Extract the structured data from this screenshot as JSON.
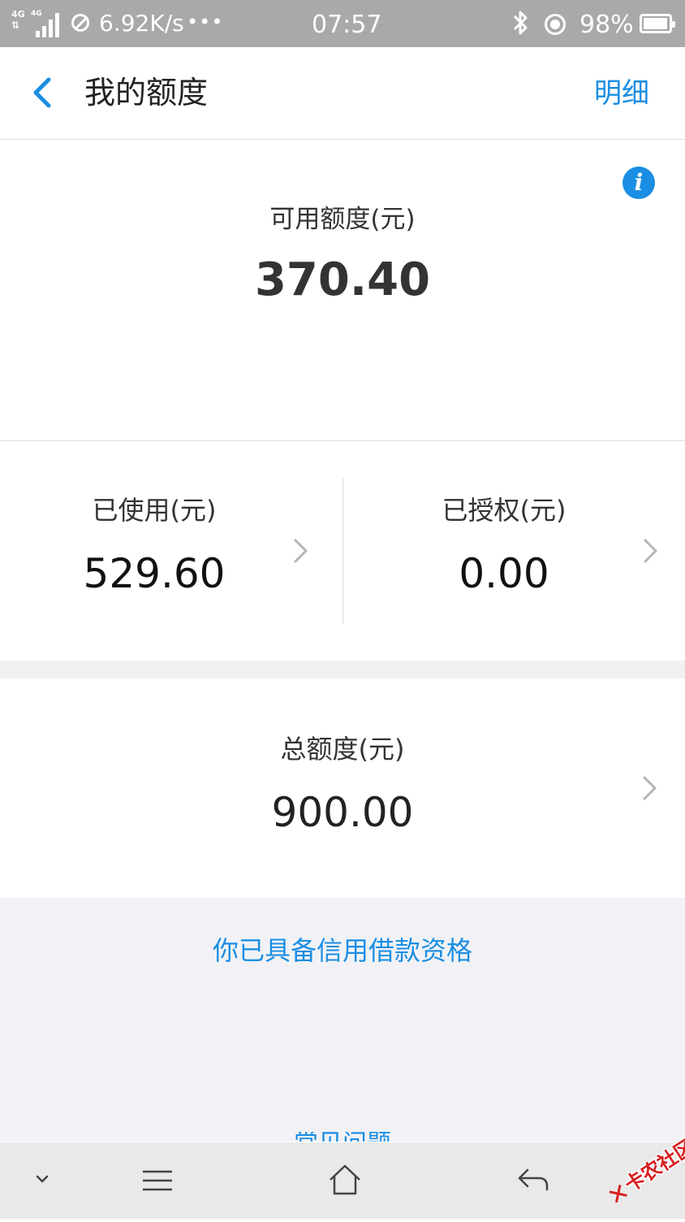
{
  "status_bar": {
    "network_left": "4G",
    "network_right": "4G",
    "speed": "6.92K/s",
    "more": "•••",
    "time": "07:57",
    "bluetooth_icon": "bluetooth-icon",
    "location_icon": "location-icon",
    "battery_percent": "98%",
    "battery_level": 0.98
  },
  "header": {
    "title": "我的额度",
    "detail_label": "明细"
  },
  "available": {
    "label": "可用额度(元)",
    "value": "370.40"
  },
  "used": {
    "label": "已使用(元)",
    "value": "529.60"
  },
  "authorized": {
    "label": "已授权(元)",
    "value": "0.00"
  },
  "total": {
    "label": "总额度(元)",
    "value": "900.00"
  },
  "eligibility": {
    "text": "你已具备信用借款资格",
    "partial_text": "常见问题"
  },
  "watermark": {
    "text": "卡农社区"
  },
  "colors": {
    "accent": "#1a8ee3",
    "status_bar": "#a9a9a9",
    "page_bg": "#f2f2f6"
  }
}
